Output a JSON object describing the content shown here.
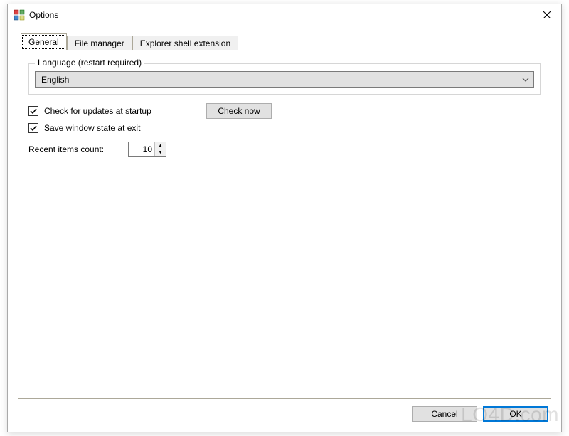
{
  "window": {
    "title": "Options"
  },
  "tabs": [
    {
      "label": "General",
      "active": true
    },
    {
      "label": "File manager",
      "active": false
    },
    {
      "label": "Explorer shell extension",
      "active": false
    }
  ],
  "general": {
    "language_group_label": "Language (restart required)",
    "language_selected": "English",
    "check_updates_label": "Check for updates at startup",
    "check_updates_checked": true,
    "check_now_label": "Check now",
    "save_window_state_label": "Save window state at exit",
    "save_window_state_checked": true,
    "recent_items_label": "Recent items count:",
    "recent_items_value": "10"
  },
  "footer": {
    "cancel_label": "Cancel",
    "ok_label": "OK"
  },
  "watermark": "LO4D.com"
}
